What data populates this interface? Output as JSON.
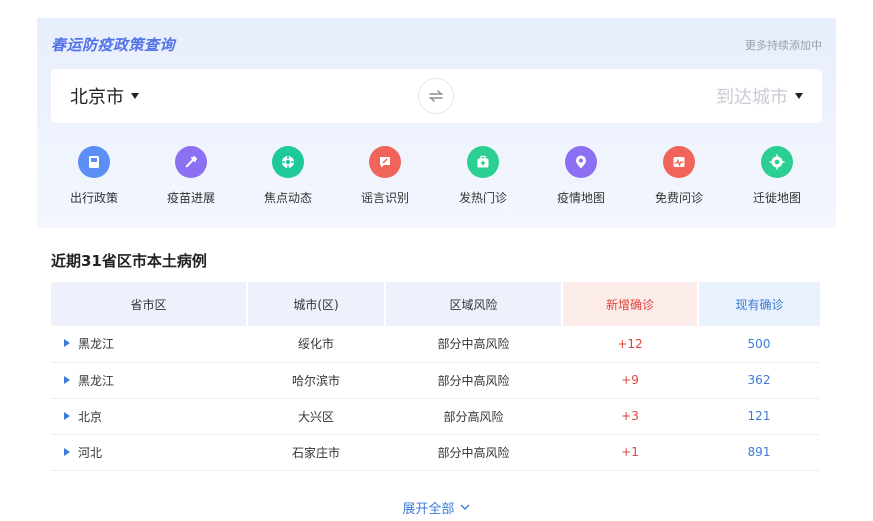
{
  "panel": {
    "title": "春运防疫政策查询",
    "more": "更多持续添加中"
  },
  "city_bar": {
    "from": "北京市",
    "to": "到达城市"
  },
  "features": [
    {
      "label": "出行政策",
      "icon": "document-icon",
      "color": "#5b8ff5"
    },
    {
      "label": "疫苗进展",
      "icon": "syringe-icon",
      "color": "#8c6ff2"
    },
    {
      "label": "焦点动态",
      "icon": "pinwheel-icon",
      "color": "#1ec99a"
    },
    {
      "label": "谣言识别",
      "icon": "chat-alert-icon",
      "color": "#f0645a"
    },
    {
      "label": "发热门诊",
      "icon": "medical-kit-icon",
      "color": "#2ccf92"
    },
    {
      "label": "疫情地图",
      "icon": "map-pin-icon",
      "color": "#8c6ff2"
    },
    {
      "label": "免费问诊",
      "icon": "pulse-monitor-icon",
      "color": "#f0645a"
    },
    {
      "label": "迁徙地图",
      "icon": "target-icon",
      "color": "#2ccf92"
    }
  ],
  "section_title": "近期31省区市本土病例",
  "table": {
    "headers": [
      "省市区",
      "城市(区)",
      "区域风险",
      "新增确诊",
      "现有确诊"
    ],
    "rows": [
      {
        "province": "黑龙江",
        "city": "绥化市",
        "risk": "部分中高风险",
        "new": "+12",
        "current": "500"
      },
      {
        "province": "黑龙江",
        "city": "哈尔滨市",
        "risk": "部分中高风险",
        "new": "+9",
        "current": "362"
      },
      {
        "province": "北京",
        "city": "大兴区",
        "risk": "部分高风险",
        "new": "+3",
        "current": "121"
      },
      {
        "province": "河北",
        "city": "石家庄市",
        "risk": "部分中高风险",
        "new": "+1",
        "current": "891"
      }
    ]
  },
  "expand_label": "展开全部",
  "colors": {
    "accent_blue": "#3c7bd8",
    "accent_red": "#e0433c",
    "title_blue": "#5472e8"
  }
}
